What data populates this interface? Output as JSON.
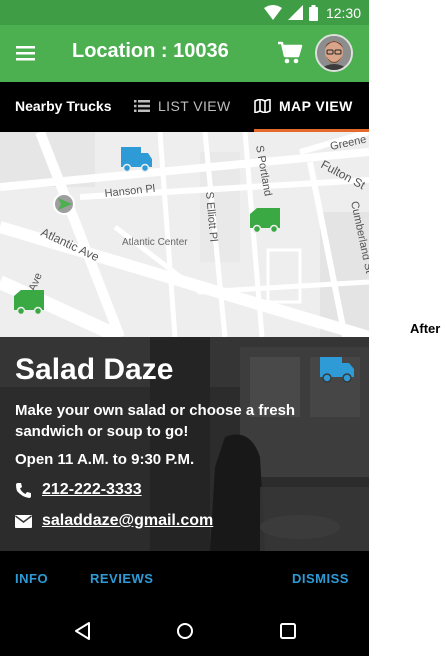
{
  "status_bar": {
    "time": "12:30"
  },
  "app_bar": {
    "title": "Location : 10036"
  },
  "tabs": {
    "nearby": "Nearby Trucks",
    "list_view": "LIST VIEW",
    "map_view": "MAP VIEW"
  },
  "map": {
    "streets": [
      "Hanson Pl",
      "Atlantic Ave",
      "S Elliott Pl",
      "S Portland",
      "Fulton St",
      "Cumberland St",
      "Greene",
      "Ave"
    ],
    "places": [
      "Atlantic Center"
    ]
  },
  "truck": {
    "name": "Salad Daze",
    "description": "Make your own salad or choose a fresh sandwich or soup to go!",
    "hours": "Open 11 A.M. to 9:30 P.M.",
    "phone": "212-222-3333",
    "email": "saladdaze@gmail.com"
  },
  "actions": {
    "info": "INFO",
    "reviews": "REVIEWS",
    "dismiss": "DISMISS"
  },
  "side_label": "After",
  "colors": {
    "app_bar": "#4caf50",
    "status_bar": "#3f9d45",
    "accent_orange": "#e46a2b",
    "action_blue": "#2e9bd6",
    "truck_blue": "#2e9bd6",
    "truck_green": "#3aa843"
  },
  "icons": [
    "wifi-icon",
    "signal-icon",
    "battery-icon",
    "menu-icon",
    "cart-icon",
    "avatar",
    "list-icon",
    "map-icon",
    "location-arrow-icon",
    "truck-icon",
    "phone-icon",
    "email-icon",
    "back-icon",
    "home-icon",
    "recents-icon"
  ]
}
